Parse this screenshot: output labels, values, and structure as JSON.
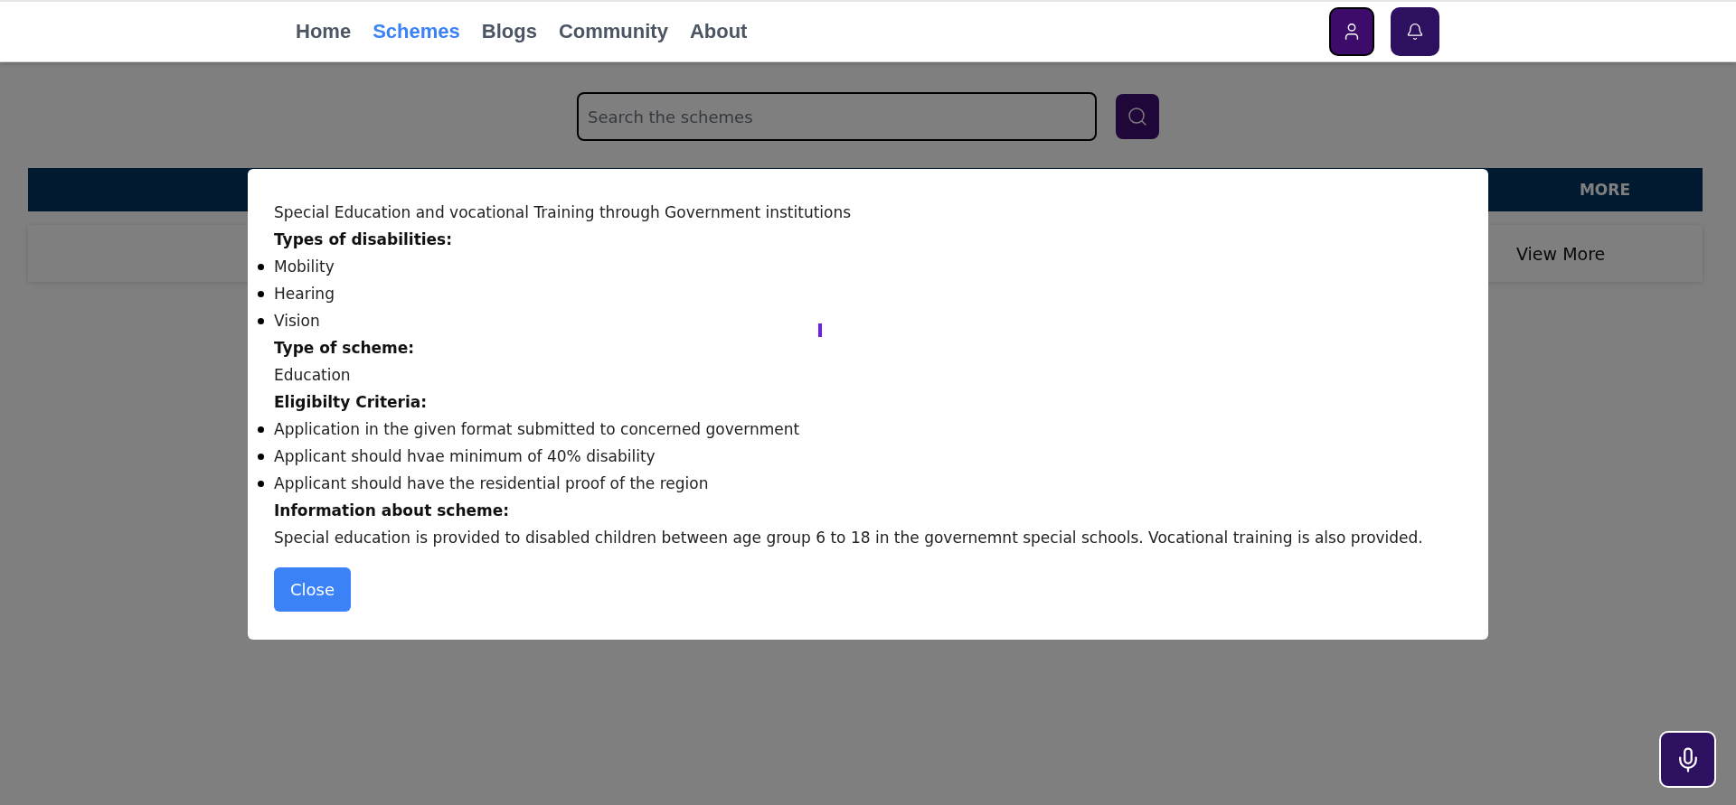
{
  "nav": {
    "links": [
      {
        "label": "Home",
        "selected": false
      },
      {
        "label": "Schemes",
        "selected": true
      },
      {
        "label": "Blogs",
        "selected": false
      },
      {
        "label": "Community",
        "selected": false
      },
      {
        "label": "About",
        "selected": false
      }
    ]
  },
  "search": {
    "placeholder": "Search the schemes"
  },
  "table": {
    "columns": [
      "MORE"
    ],
    "rows": [
      {
        "cells": [
          "View More"
        ]
      }
    ]
  },
  "modal": {
    "title": "Special Education and vocational Training through Government institutions",
    "sections": [
      {
        "heading": "Types of disabilities:",
        "kind": "list",
        "items": [
          "Mobility",
          "Hearing",
          "Vision"
        ]
      },
      {
        "heading": "Type of scheme:",
        "kind": "text",
        "text": "Education"
      },
      {
        "heading": "Eligibilty Criteria:",
        "kind": "list",
        "items": [
          "Application in the given format submitted to concerned government",
          "Applicant should hvae minimum of 40% disability",
          "Applicant should have the residential proof of the region"
        ]
      },
      {
        "heading": "Information about scheme:",
        "kind": "text",
        "text": "Special education is provided to disabled children between age group 6 to 18 in the governemnt special schools. Vocational training is also provided."
      }
    ],
    "close_button": "Close"
  }
}
